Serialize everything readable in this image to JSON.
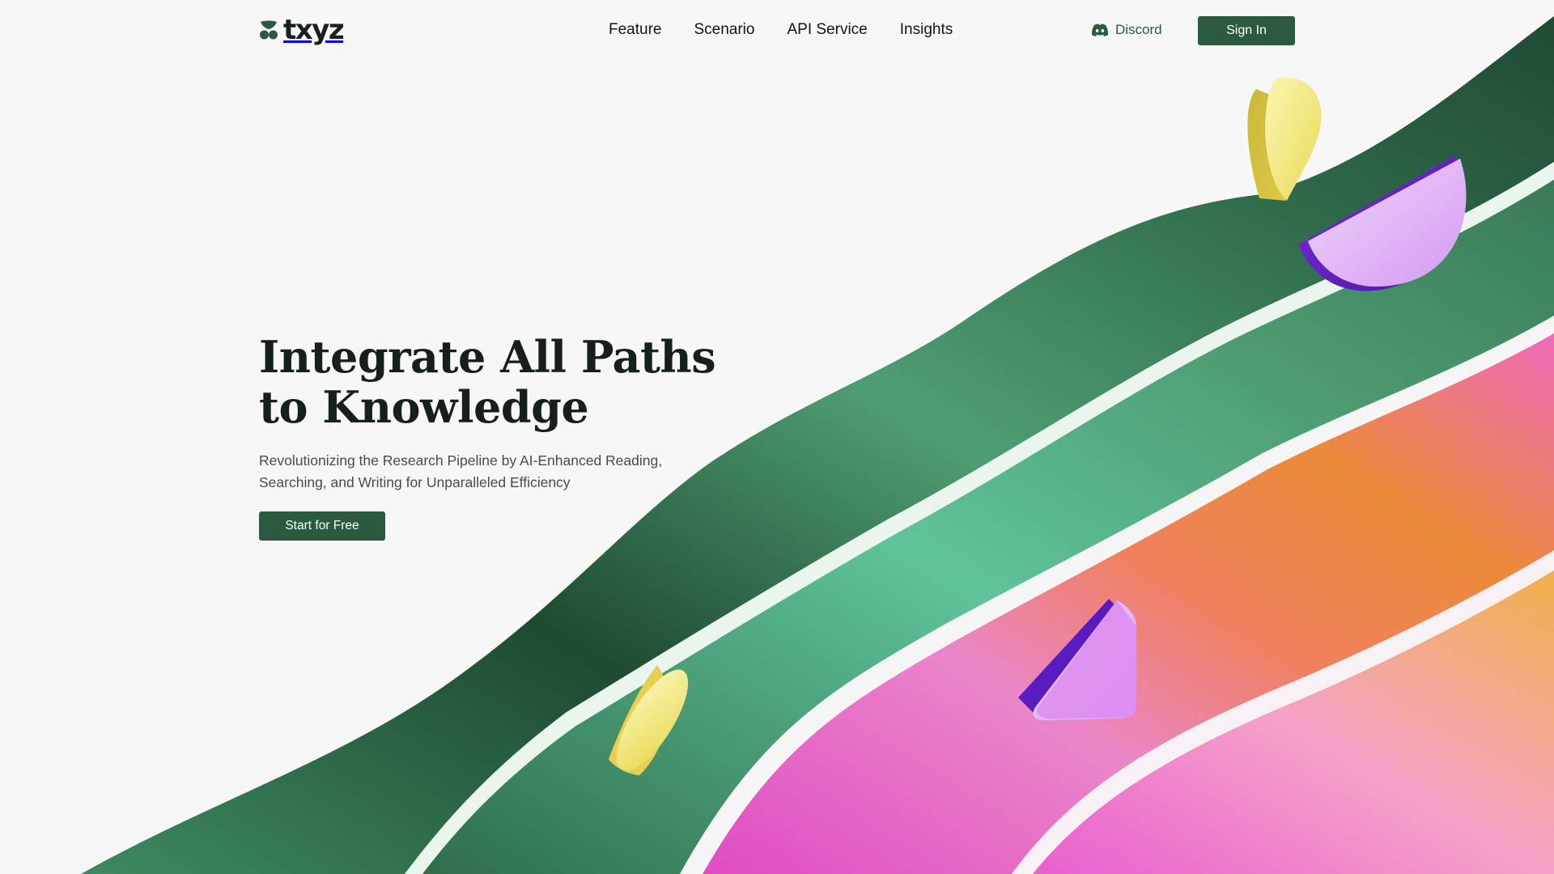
{
  "brand": {
    "name": "txyz",
    "logo_icon": "txyz-logo-icon"
  },
  "nav": {
    "items": [
      {
        "label": "Feature"
      },
      {
        "label": "Scenario"
      },
      {
        "label": "API Service"
      },
      {
        "label": "Insights"
      }
    ]
  },
  "header": {
    "discord_label": "Discord",
    "discord_icon": "discord-icon",
    "signin_label": "Sign In"
  },
  "hero": {
    "title_line1": "Integrate All Paths",
    "title_line2": "to Knowledge",
    "subtitle": "Revolutionizing the Research Pipeline by AI-Enhanced Reading, Searching, and Writing for Unparalleled Efficiency",
    "cta_label": "Start for Free"
  },
  "colors": {
    "accent": "#2b5a40",
    "background": "#f7f7f7",
    "ribbon_green": "#4e9d72",
    "ribbon_pink": "#e766c8",
    "ribbon_orange": "#f0a048",
    "shape_yellow": "#f4ec8e",
    "shape_purple": "#a64ee8"
  }
}
